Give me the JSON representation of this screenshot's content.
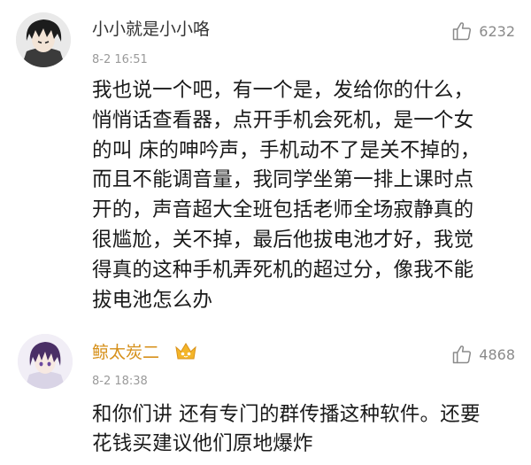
{
  "comments": [
    {
      "username": "小小就是小小咯",
      "avatar": "anime-avatar-icon",
      "timestamp": "8-2 16:51",
      "likes": "6232",
      "body_lines": [
        "我也说一个吧，有一个是，发给你的什么，",
        "悄悄话查看器，点开手机会死机，是一个女",
        "的叫 床的呻吟声，手机动不了是关不掉的，",
        "而且不能调音量，我同学坐第一排上课时点",
        "开的，声音超大全班包括老师全场寂静真的",
        "很尴尬，关不掉，最后他拔电池才好，我觉",
        "得真的这种手机弄死机的超过分，像我不能",
        "拔电池怎么办"
      ]
    },
    {
      "username": "鲸太炭二",
      "avatar": "anime-avatar-icon",
      "badge": "crown-vip-icon",
      "timestamp": "8-2 18:38",
      "likes": "4868",
      "body_lines": [
        "和你们讲 还有专门的群传播这种软件。还要",
        "花钱买建议他们原地爆炸"
      ]
    }
  ],
  "colors": {
    "vip_username": "#d6901a",
    "username": "#333333",
    "timestamp": "#9a9a9a",
    "like": "#8a8a8a"
  }
}
